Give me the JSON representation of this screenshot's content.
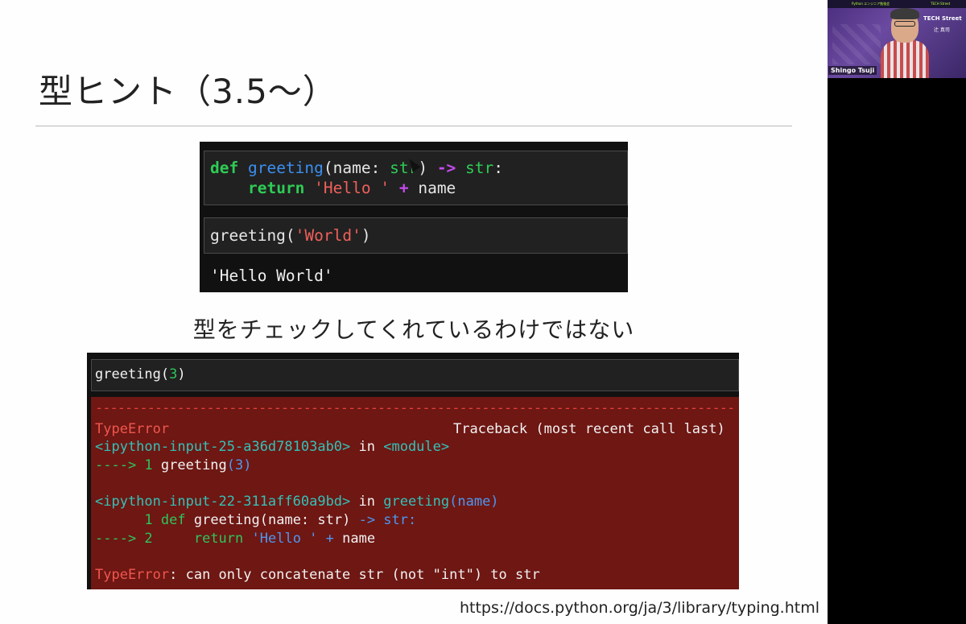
{
  "slide": {
    "title": "型ヒント（3.5〜）",
    "caption": "型をチェックしてくれているわけではない",
    "url": "https://docs.python.org/ja/3/library/typing.html"
  },
  "notebook1": {
    "cell1_line1": {
      "def": "def",
      "fn": "greeting",
      "args": "(name: ",
      "ty1": "str",
      "close": ") ",
      "arrow": "->",
      "sp": " ",
      "ret_ty": "str",
      "colon": ":"
    },
    "cell1_line2": {
      "indent": "    ",
      "ret": "return",
      "sp1": " ",
      "s": "'Hello '",
      "sp2": " ",
      "plus": "+",
      "rest": " name"
    },
    "cell2": {
      "fn": "greeting(",
      "arg": "'World'",
      "close": ")"
    },
    "output": "'Hello World'"
  },
  "notebook2": {
    "input": {
      "fn": "greeting(",
      "arg": "3",
      "close": ")"
    },
    "dashes": "-----------------------------------------------------------------------------------------",
    "line_typeerror": "TypeError",
    "line_traceback": "Traceback (most recent call last)",
    "frame1": {
      "file": "<ipython-input-25-a36d78103ab0>",
      "in": " in ",
      "where": "<module>"
    },
    "frame1_code": {
      "arrow": "----> 1 ",
      "fn": "greeting",
      "paren": "(",
      "num": "3",
      "close": ")"
    },
    "frame2": {
      "file": "<ipython-input-22-311aff60a9bd>",
      "in": " in ",
      "fn": "greeting",
      "args": "(name)"
    },
    "frame2_code1": {
      "lineno": "      1 ",
      "def": "def",
      "sp": " ",
      "fn": "greeting",
      "args": "(name: str) ",
      "arrow": "->",
      "ret": " str:"
    },
    "frame2_code2": {
      "arrow": "----> 2 ",
      "indent": "    ",
      "ret": "return",
      "sp": " ",
      "s": "'Hello '",
      "plus": " + ",
      "name": "name"
    },
    "final": {
      "err": "TypeError",
      "msg": ": can only concatenate str (not \"int\") to str"
    }
  },
  "webcam": {
    "presenter_name": "Shingo Tsuji",
    "brand": "TECH Street",
    "sub": "辻 真司",
    "banner_left": "Python エンジニア勉強会",
    "banner_right": "TECH Street"
  },
  "colors": {
    "code_bg": "#212121",
    "error_bg": "#6e1713",
    "keyword": "#2ecc55",
    "function": "#3b8ff0",
    "string": "#f0605a",
    "operator": "#c64bf0"
  }
}
